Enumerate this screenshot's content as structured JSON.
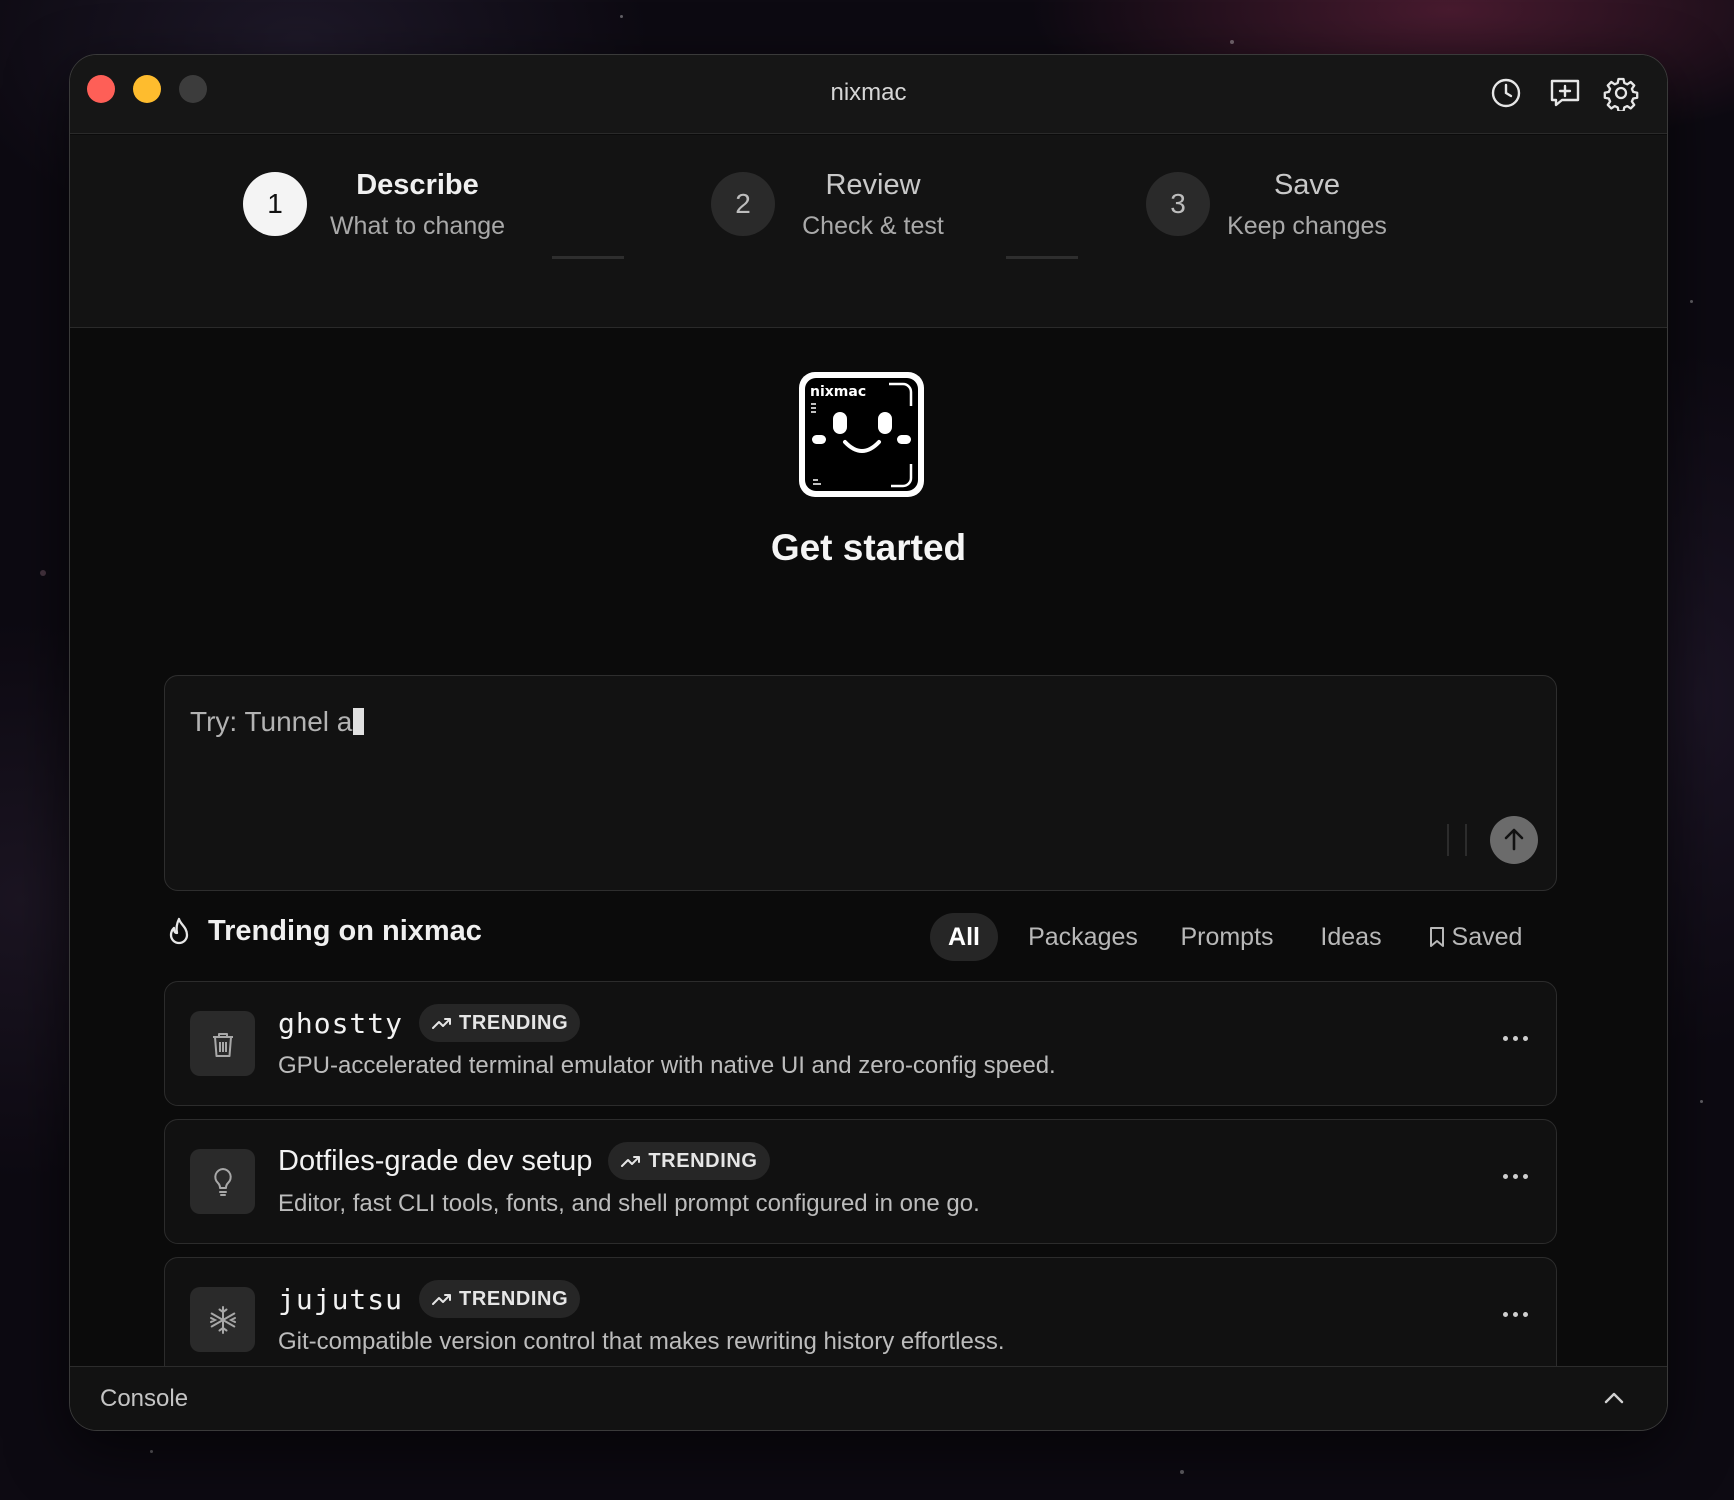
{
  "window": {
    "title": "nixmac"
  },
  "toolbar": {
    "icons": [
      "history-icon",
      "new-chat-icon",
      "settings-icon"
    ]
  },
  "steps": [
    {
      "number": "1",
      "title": "Describe",
      "subtitle": "What to change",
      "active": true
    },
    {
      "number": "2",
      "title": "Review",
      "subtitle": "Check & test",
      "active": false
    },
    {
      "number": "3",
      "title": "Save",
      "subtitle": "Keep changes",
      "active": false
    }
  ],
  "hero": {
    "logo_text": "nixmac",
    "heading": "Get started"
  },
  "prompt": {
    "placeholder": "Try: Tunnel a"
  },
  "trending": {
    "title": "Trending on nixmac",
    "filters": [
      {
        "label": "All",
        "active": true
      },
      {
        "label": "Packages",
        "active": false
      },
      {
        "label": "Prompts",
        "active": false
      },
      {
        "label": "Ideas",
        "active": false
      },
      {
        "label": "Saved",
        "active": false
      }
    ],
    "items": [
      {
        "name": "ghostty",
        "badge": "TRENDING",
        "description": "GPU-accelerated terminal emulator with native UI and zero-config speed.",
        "icon": "package-icon"
      },
      {
        "name": "Dotfiles-grade dev setup",
        "badge": "TRENDING",
        "description": "Editor, fast CLI tools, fonts, and shell prompt configured in one go.",
        "icon": "lightbulb-icon"
      },
      {
        "name": "jujutsu",
        "badge": "TRENDING",
        "description": "Git-compatible version control that makes rewriting history effortless.",
        "icon": "snowflake-icon"
      }
    ]
  },
  "console": {
    "label": "Console"
  },
  "colors": {
    "background": "#0b0b0b",
    "accent": "#f4f4f4",
    "close": "#fe5f57",
    "minimize": "#febc2e"
  }
}
